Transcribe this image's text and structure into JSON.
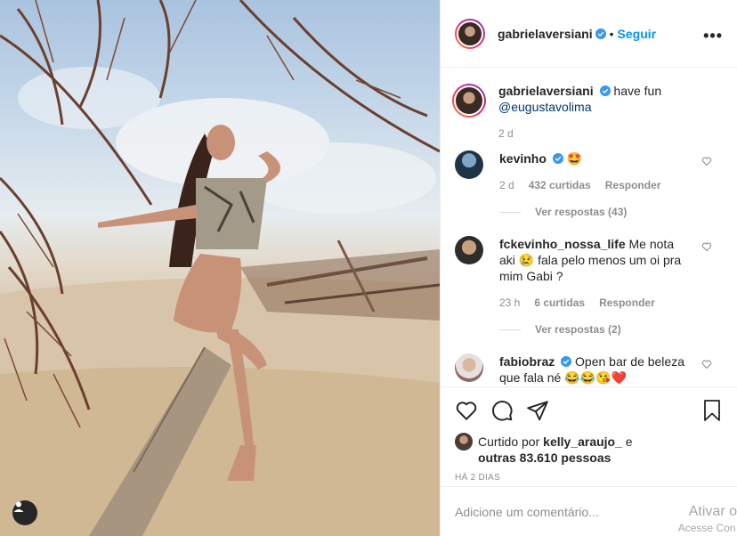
{
  "post": {
    "username": "gabrielaversiani",
    "follow_label": "Seguir",
    "dot": "•",
    "more_label": "•••"
  },
  "caption": {
    "username": "gabrielaversiani",
    "text": "have fun",
    "mention": "@eugustavolima",
    "time": "2 d"
  },
  "comments": [
    {
      "username": "kevinho",
      "verified": true,
      "text": "🤩",
      "time": "2 d",
      "likes": "432 curtidas",
      "reply_label": "Responder",
      "view_replies": "Ver respostas (43)"
    },
    {
      "username": "fckevinho_nossa_life",
      "verified": false,
      "text": "Me nota aki 😢 fala pelo menos um oi pra mim Gabi ?",
      "time": "23 h",
      "likes": "6 curtidas",
      "reply_label": "Responder",
      "view_replies": "Ver respostas (2)"
    },
    {
      "username": "fabiobraz",
      "verified": true,
      "text": "Open bar de beleza que fala né 😂😂😘❤️"
    }
  ],
  "likes": {
    "prefix": "Curtido por",
    "user": "kelly_araujo_",
    "connector": "e",
    "others": "outras 83.610 pessoas"
  },
  "timestamp": "HÁ 2 DIAS",
  "add_comment": {
    "placeholder": "Adicione um comentário..."
  },
  "watermark": {
    "line1": "Ativar o",
    "line2": "Acesse Con"
  },
  "icons": [
    "heart-icon",
    "comment-icon",
    "share-icon",
    "bookmark-icon",
    "user-tag-icon",
    "verified-icon",
    "more-options-icon"
  ],
  "colors": {
    "accent": "#0095f6",
    "verified": "#3897f0",
    "text": "#262626",
    "muted": "#8e8e8e"
  }
}
